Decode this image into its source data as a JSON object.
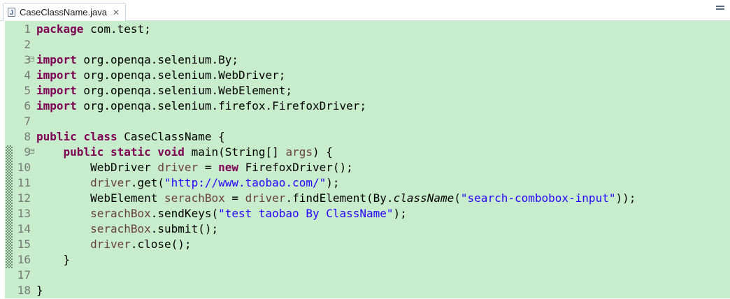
{
  "tab": {
    "label": "CaseClassName.java",
    "icon": "java-file-icon",
    "close": "✕"
  },
  "colors": {
    "editor_bg": "#c7edcc",
    "keyword": "#7f0055",
    "string": "#2a00ff",
    "local_var": "#6a3e3e",
    "line_number": "#787878"
  },
  "lines": [
    {
      "n": "1",
      "fold": "",
      "tokens": [
        {
          "t": "package",
          "c": "kw"
        },
        {
          "t": " com.test;",
          "c": ""
        }
      ]
    },
    {
      "n": "2",
      "fold": "",
      "tokens": []
    },
    {
      "n": "3",
      "fold": "−",
      "tokens": [
        {
          "t": "import",
          "c": "kw"
        },
        {
          "t": " org.openqa.selenium.By;",
          "c": ""
        }
      ]
    },
    {
      "n": "4",
      "fold": "",
      "tokens": [
        {
          "t": "import",
          "c": "kw"
        },
        {
          "t": " org.openqa.selenium.WebDriver;",
          "c": ""
        }
      ]
    },
    {
      "n": "5",
      "fold": "",
      "tokens": [
        {
          "t": "import",
          "c": "kw"
        },
        {
          "t": " org.openqa.selenium.WebElement;",
          "c": ""
        }
      ]
    },
    {
      "n": "6",
      "fold": "",
      "tokens": [
        {
          "t": "import",
          "c": "kw"
        },
        {
          "t": " org.openqa.selenium.firefox.FirefoxDriver;",
          "c": ""
        }
      ]
    },
    {
      "n": "7",
      "fold": "",
      "tokens": []
    },
    {
      "n": "8",
      "fold": "",
      "tokens": [
        {
          "t": "public",
          "c": "kw"
        },
        {
          "t": " ",
          "c": ""
        },
        {
          "t": "class",
          "c": "kw"
        },
        {
          "t": " CaseClassName {",
          "c": ""
        }
      ]
    },
    {
      "n": "9",
      "fold": "−",
      "tokens": [
        {
          "t": "    ",
          "c": ""
        },
        {
          "t": "public",
          "c": "kw"
        },
        {
          "t": " ",
          "c": ""
        },
        {
          "t": "static",
          "c": "kw"
        },
        {
          "t": " ",
          "c": ""
        },
        {
          "t": "void",
          "c": "kw"
        },
        {
          "t": " main(String[] ",
          "c": ""
        },
        {
          "t": "args",
          "c": "var"
        },
        {
          "t": ") {",
          "c": ""
        }
      ]
    },
    {
      "n": "10",
      "fold": "",
      "tokens": [
        {
          "t": "        WebDriver ",
          "c": ""
        },
        {
          "t": "driver",
          "c": "var"
        },
        {
          "t": " = ",
          "c": ""
        },
        {
          "t": "new",
          "c": "kw"
        },
        {
          "t": " FirefoxDriver();",
          "c": ""
        }
      ]
    },
    {
      "n": "11",
      "fold": "",
      "tokens": [
        {
          "t": "        ",
          "c": ""
        },
        {
          "t": "driver",
          "c": "var"
        },
        {
          "t": ".get(",
          "c": ""
        },
        {
          "t": "\"http://www.taobao.com/\"",
          "c": "str"
        },
        {
          "t": ");",
          "c": ""
        }
      ]
    },
    {
      "n": "12",
      "fold": "",
      "tokens": [
        {
          "t": "        WebElement ",
          "c": ""
        },
        {
          "t": "serachBox",
          "c": "var"
        },
        {
          "t": " = ",
          "c": ""
        },
        {
          "t": "driver",
          "c": "var"
        },
        {
          "t": ".findElement(By.",
          "c": ""
        },
        {
          "t": "className",
          "c": "it"
        },
        {
          "t": "(",
          "c": ""
        },
        {
          "t": "\"search-combobox-input\"",
          "c": "str"
        },
        {
          "t": "));",
          "c": ""
        }
      ]
    },
    {
      "n": "13",
      "fold": "",
      "tokens": [
        {
          "t": "        ",
          "c": ""
        },
        {
          "t": "serachBox",
          "c": "var"
        },
        {
          "t": ".sendKeys(",
          "c": ""
        },
        {
          "t": "\"test taobao By ClassName\"",
          "c": "str"
        },
        {
          "t": ");",
          "c": ""
        }
      ]
    },
    {
      "n": "14",
      "fold": "",
      "tokens": [
        {
          "t": "        ",
          "c": ""
        },
        {
          "t": "serachBox",
          "c": "var"
        },
        {
          "t": ".submit();",
          "c": ""
        }
      ]
    },
    {
      "n": "15",
      "fold": "",
      "tokens": [
        {
          "t": "        ",
          "c": ""
        },
        {
          "t": "driver",
          "c": "var"
        },
        {
          "t": ".close();",
          "c": ""
        }
      ]
    },
    {
      "n": "16",
      "fold": "",
      "tokens": [
        {
          "t": "    }",
          "c": ""
        }
      ]
    },
    {
      "n": "17",
      "fold": "",
      "tokens": []
    },
    {
      "n": "18",
      "fold": "",
      "tokens": [
        {
          "t": "}",
          "c": ""
        }
      ]
    }
  ]
}
